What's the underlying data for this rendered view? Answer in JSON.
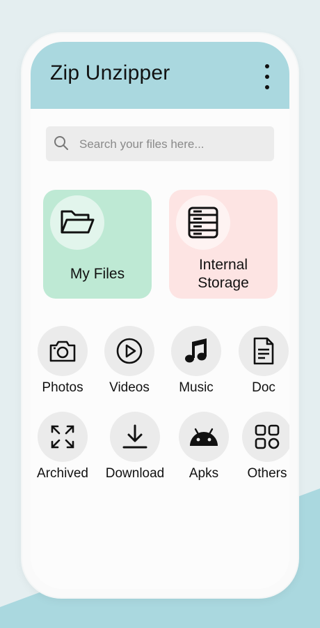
{
  "header": {
    "title": "Zip Unzipper",
    "menu_icon": "more-vertical-icon"
  },
  "search": {
    "placeholder": "Search your files here...",
    "value": "",
    "icon": "search-icon"
  },
  "cards": [
    {
      "label": "My Files",
      "icon": "folder-open-icon",
      "color": "#bee9d4"
    },
    {
      "label": "Internal\nStorage",
      "icon": "storage-icon",
      "color": "#fde4e3"
    }
  ],
  "categories": [
    {
      "label": "Photos",
      "icon": "camera-icon"
    },
    {
      "label": "Videos",
      "icon": "play-circle-icon"
    },
    {
      "label": "Music",
      "icon": "music-note-icon"
    },
    {
      "label": "Doc",
      "icon": "document-icon"
    },
    {
      "label": "Archived",
      "icon": "expand-icon"
    },
    {
      "label": "Download",
      "icon": "download-icon"
    },
    {
      "label": "Apks",
      "icon": "android-icon"
    },
    {
      "label": "Others",
      "icon": "grid-icon"
    }
  ],
  "colors": {
    "appbar": "#aad8df",
    "background": "#e4eef0",
    "accent_wedge": "#aad8df"
  }
}
